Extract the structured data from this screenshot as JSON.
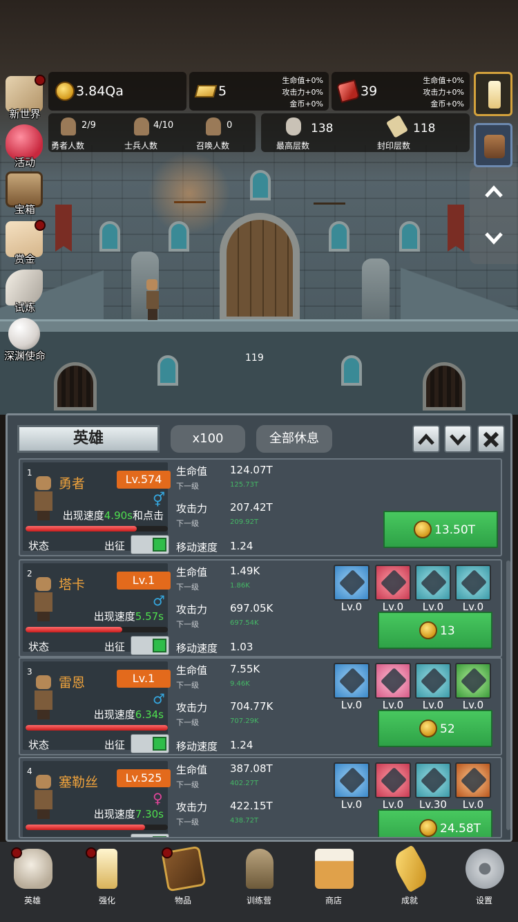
{
  "resources": {
    "gold": "3.84Qa",
    "gold_bar": "5",
    "gold_bar_bonus": [
      "生命值+0%",
      "攻击力+0%",
      "金币+0%"
    ],
    "ruby": "39",
    "ruby_bonus": [
      "生命值+0%",
      "攻击力+0%",
      "金币+0%"
    ]
  },
  "stats": {
    "heroes": {
      "value": "2/9",
      "label": "勇者人数"
    },
    "soldiers": {
      "value": "4/10",
      "label": "士兵人数"
    },
    "summons": {
      "value": "0",
      "label": "召唤人数"
    },
    "max_floor": {
      "value": "138",
      "label": "最高层数"
    },
    "sealed_floor": {
      "value": "118",
      "label": "封印层数"
    }
  },
  "side_menu": [
    {
      "label": "新世界",
      "icon": "map-icon",
      "badge": true
    },
    {
      "label": "活动",
      "icon": "heart-icon",
      "badge": false
    },
    {
      "label": "宝箱",
      "icon": "chest-icon",
      "badge": false
    },
    {
      "label": "赏金",
      "icon": "envelope-icon",
      "badge": true
    },
    {
      "label": "试炼",
      "icon": "feather-icon",
      "badge": false
    },
    {
      "label": "深渊使命",
      "icon": "pearl-icon",
      "badge": false
    }
  ],
  "scene": {
    "floor_number": "119"
  },
  "panel": {
    "tab": "英雄",
    "multiplier": "x100",
    "rest_all": "全部休息",
    "up": "▲",
    "down": "▼",
    "close": "✕"
  },
  "labels": {
    "hp": "生命值",
    "atk": "攻击力",
    "next": "下一级",
    "move_speed": "移动速度",
    "state": "状态",
    "deploy": "出征",
    "spawn_speed": "出现速度"
  },
  "heroes": [
    {
      "idx": "1",
      "name": "勇者",
      "level": "Lv.574",
      "gender": "⚥",
      "gender_color": "#35a8e0",
      "speed": "4.90s",
      "speed_suffix": "和点击",
      "hp_fill": 0.78,
      "hp": "124.07T",
      "hp_next": "125.73T",
      "atk": "207.42T",
      "atk_next": "209.92T",
      "move": "1.24",
      "cost": "13.50T",
      "gear": []
    },
    {
      "idx": "2",
      "name": "塔卡",
      "level": "Lv.1",
      "gender": "♂",
      "gender_color": "#35a8e0",
      "speed": "5.57s",
      "speed_suffix": "",
      "hp_fill": 0.68,
      "hp": "1.49K",
      "hp_next": "1.86K",
      "atk": "697.05K",
      "atk_next": "697.54K",
      "move": "1.03",
      "cost": "13",
      "gear": [
        {
          "lv": "Lv.0",
          "color": "blue",
          "icon": "axe-icon"
        },
        {
          "lv": "Lv.0",
          "color": "red",
          "icon": "double-axe-icon"
        },
        {
          "lv": "Lv.0",
          "color": "teal",
          "icon": "boots-icon"
        },
        {
          "lv": "Lv.0",
          "color": "teal",
          "icon": "hammer-icon"
        }
      ]
    },
    {
      "idx": "3",
      "name": "雷恩",
      "level": "Lv.1",
      "gender": "♂",
      "gender_color": "#35a8e0",
      "speed": "6.34s",
      "speed_suffix": "",
      "hp_fill": 1.0,
      "hp": "7.55K",
      "hp_next": "9.46K",
      "atk": "704.77K",
      "atk_next": "707.29K",
      "move": "1.24",
      "cost": "52",
      "gear": [
        {
          "lv": "Lv.0",
          "color": "blue",
          "icon": "sword-icon"
        },
        {
          "lv": "Lv.0",
          "color": "pink",
          "icon": "blade-icon"
        },
        {
          "lv": "Lv.0",
          "color": "teal",
          "icon": "boots-icon"
        },
        {
          "lv": "Lv.0",
          "color": "green",
          "icon": "serpent-icon"
        }
      ]
    },
    {
      "idx": "4",
      "name": "塞勒丝",
      "level": "Lv.525",
      "gender": "♀",
      "gender_color": "#e0459a",
      "speed": "7.30s",
      "speed_suffix": "",
      "hp_fill": 0.84,
      "hp": "387.08T",
      "hp_next": "402.27T",
      "atk": "422.15T",
      "atk_next": "438.72T",
      "move": "",
      "cost": "24.58T",
      "gear": [
        {
          "lv": "Lv.0",
          "color": "blue",
          "icon": "star-shield-icon"
        },
        {
          "lv": "Lv.0",
          "color": "red",
          "icon": "fang-icon"
        },
        {
          "lv": "Lv.30",
          "color": "teal",
          "icon": "boots-icon"
        },
        {
          "lv": "Lv.0",
          "color": "orange",
          "icon": "cage-icon"
        }
      ]
    }
  ],
  "nav": [
    {
      "label": "英雄",
      "icon": "skull-icon",
      "badge": true
    },
    {
      "label": "强化",
      "icon": "candle-icon",
      "badge": true
    },
    {
      "label": "物品",
      "icon": "book-icon",
      "badge": true
    },
    {
      "label": "训练营",
      "icon": "lantern-icon",
      "badge": false
    },
    {
      "label": "商店",
      "icon": "beer-mug-icon",
      "badge": false
    },
    {
      "label": "成就",
      "icon": "key-icon",
      "badge": false
    },
    {
      "label": "设置",
      "icon": "gear-icon",
      "badge": false
    }
  ]
}
